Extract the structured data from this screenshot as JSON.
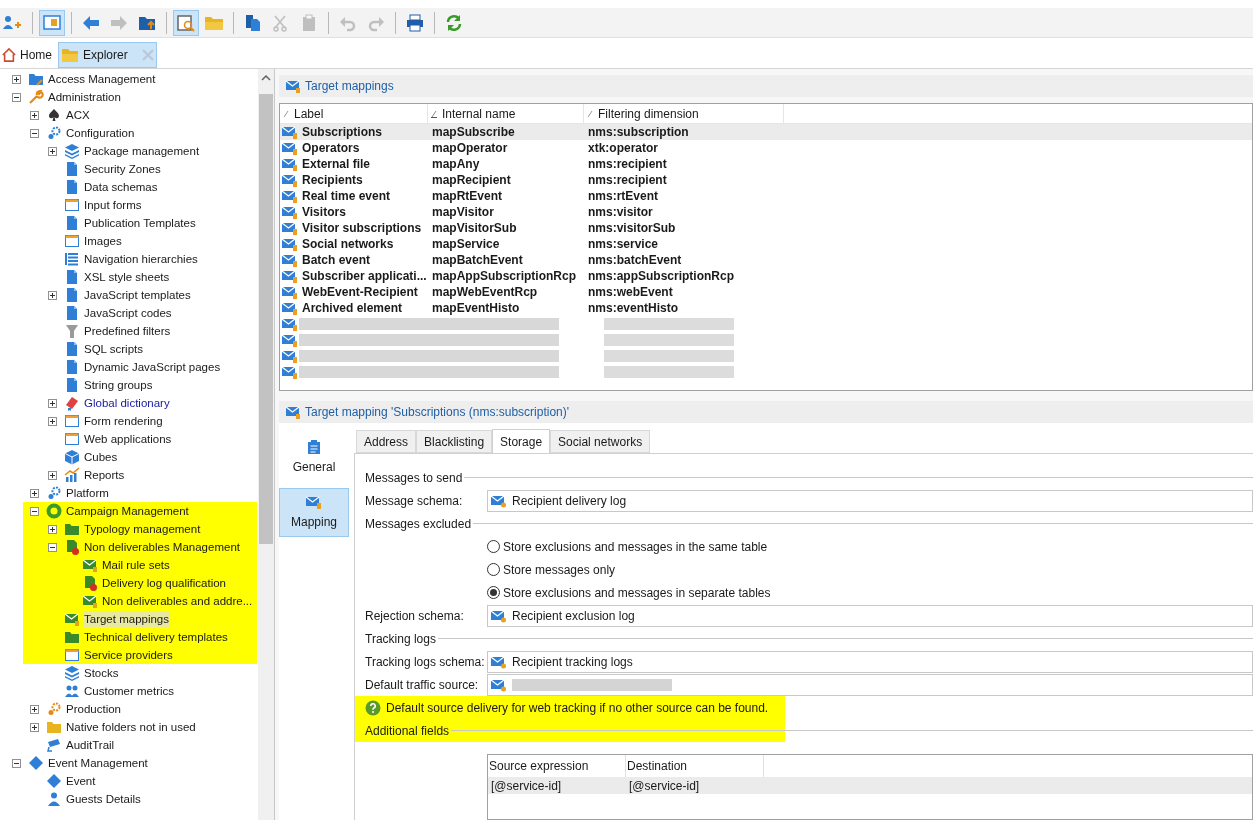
{
  "toolbar": [
    {
      "kind": "add-user",
      "pressed": false,
      "disabled": false
    },
    {
      "kind": "separator"
    },
    {
      "kind": "panel",
      "pressed": true,
      "disabled": false
    },
    {
      "kind": "separator"
    },
    {
      "kind": "back",
      "pressed": false,
      "disabled": false
    },
    {
      "kind": "forward",
      "pressed": false,
      "disabled": true
    },
    {
      "kind": "folder-up",
      "pressed": false,
      "disabled": false
    },
    {
      "kind": "separator"
    },
    {
      "kind": "preview",
      "pressed": true,
      "disabled": false
    },
    {
      "kind": "folder",
      "pressed": false,
      "disabled": false
    },
    {
      "kind": "separator"
    },
    {
      "kind": "copy",
      "pressed": false,
      "disabled": false
    },
    {
      "kind": "cut",
      "pressed": false,
      "disabled": true
    },
    {
      "kind": "paste",
      "pressed": false,
      "disabled": true
    },
    {
      "kind": "separator"
    },
    {
      "kind": "undo",
      "pressed": false,
      "disabled": true
    },
    {
      "kind": "redo",
      "pressed": false,
      "disabled": true
    },
    {
      "kind": "separator"
    },
    {
      "kind": "print",
      "pressed": false,
      "disabled": false
    },
    {
      "kind": "separator"
    },
    {
      "kind": "refresh",
      "pressed": false,
      "disabled": false
    }
  ],
  "tabs": [
    {
      "label": "Home",
      "kind": "home",
      "selected": false,
      "closable": false
    },
    {
      "label": "Explorer",
      "kind": "folder",
      "selected": true,
      "closable": true
    }
  ],
  "tree": [
    {
      "label": "Access Management",
      "kind": "folder-blue",
      "expanded": false,
      "selected": false,
      "highlighted": false
    },
    {
      "label": "Administration",
      "kind": "wrench",
      "expanded": true,
      "selected": false,
      "highlighted": false,
      "children": [
        {
          "label": "ACX",
          "kind": "spade",
          "expanded": false,
          "selected": false,
          "highlighted": false
        },
        {
          "label": "Configuration",
          "kind": "gears",
          "expanded": true,
          "selected": false,
          "highlighted": false,
          "children": [
            {
              "label": "Package management",
              "kind": "boxes",
              "expanded": false,
              "selected": false,
              "highlighted": false
            },
            {
              "label": "Security Zones",
              "kind": "doc",
              "selected": false,
              "highlighted": false
            },
            {
              "label": "Data schemas",
              "kind": "doc",
              "selected": false,
              "highlighted": false
            },
            {
              "label": "Input forms",
              "kind": "form",
              "selected": false,
              "highlighted": false
            },
            {
              "label": "Publication Templates",
              "kind": "doc",
              "selected": false,
              "highlighted": false
            },
            {
              "label": "Images",
              "kind": "form",
              "selected": false,
              "highlighted": false
            },
            {
              "label": "Navigation hierarchies",
              "kind": "list",
              "selected": false,
              "highlighted": false
            },
            {
              "label": "XSL style sheets",
              "kind": "doc",
              "selected": false,
              "highlighted": false
            },
            {
              "label": "JavaScript templates",
              "kind": "doc",
              "expanded": false,
              "selected": false,
              "highlighted": false
            },
            {
              "label": "JavaScript codes",
              "kind": "doc",
              "selected": false,
              "highlighted": false
            },
            {
              "label": "Predefined filters",
              "kind": "filter",
              "selected": false,
              "highlighted": false
            },
            {
              "label": "SQL scripts",
              "kind": "doc",
              "selected": false,
              "highlighted": false
            },
            {
              "label": "Dynamic JavaScript pages",
              "kind": "doc",
              "selected": false,
              "highlighted": false
            },
            {
              "label": "String groups",
              "kind": "doc",
              "selected": false,
              "highlighted": false
            },
            {
              "label": "Global dictionary",
              "kind": "book",
              "expanded": false,
              "selected": false,
              "highlighted": false,
              "linked": true
            },
            {
              "label": "Form rendering",
              "kind": "form",
              "expanded": false,
              "selected": false,
              "highlighted": false
            },
            {
              "label": "Web applications",
              "kind": "form",
              "selected": false,
              "highlighted": false
            },
            {
              "label": "Cubes",
              "kind": "cube",
              "selected": false,
              "highlighted": false
            },
            {
              "label": "Reports",
              "kind": "chart",
              "expanded": false,
              "selected": false,
              "highlighted": false
            }
          ]
        },
        {
          "label": "Platform",
          "kind": "gears",
          "expanded": false,
          "selected": false,
          "highlighted": false
        },
        {
          "label": "Campaign Management",
          "kind": "ring",
          "expanded": true,
          "selected": false,
          "highlighted": true,
          "children": [
            {
              "label": "Typology management",
              "kind": "folder-green",
              "expanded": false,
              "selected": false,
              "highlighted": true
            },
            {
              "label": "Non deliverables Management",
              "kind": "doc-alert",
              "expanded": true,
              "selected": false,
              "highlighted": true,
              "children": [
                {
                  "label": "Mail rule sets",
                  "kind": "mail-green",
                  "selected": false,
                  "highlighted": true
                },
                {
                  "label": "Delivery log qualification",
                  "kind": "doc-alert",
                  "selected": false,
                  "highlighted": true
                },
                {
                  "label": "Non deliverables and addre...",
                  "kind": "mail-green",
                  "selected": false,
                  "highlighted": true
                }
              ]
            },
            {
              "label": "Target mappings",
              "kind": "mail-green",
              "selected": true,
              "highlighted": true
            },
            {
              "label": "Technical delivery templates",
              "kind": "folder-green",
              "selected": false,
              "highlighted": true
            },
            {
              "label": "Service providers",
              "kind": "form",
              "selected": false,
              "highlighted": true
            },
            {
              "label": "Stocks",
              "kind": "boxes",
              "selected": false,
              "highlighted": false
            },
            {
              "label": "Customer metrics",
              "kind": "people",
              "selected": false,
              "highlighted": false
            }
          ]
        },
        {
          "label": "Production",
          "kind": "gears-orange",
          "expanded": false,
          "selected": false,
          "highlighted": false
        },
        {
          "label": "Native folders not in used",
          "kind": "folder-yellow",
          "expanded": false,
          "selected": false,
          "highlighted": false
        },
        {
          "label": "AuditTrail",
          "kind": "camera",
          "selected": false,
          "highlighted": false
        }
      ]
    },
    {
      "label": "Event Management",
      "kind": "diamond",
      "expanded": true,
      "selected": false,
      "highlighted": false,
      "children": [
        {
          "label": "Event",
          "kind": "diamond",
          "selected": false,
          "highlighted": false
        },
        {
          "label": "Guests Details",
          "kind": "person",
          "selected": false,
          "highlighted": false
        }
      ]
    }
  ],
  "list": {
    "title": "Target mappings",
    "columns": [
      {
        "label": "Label",
        "sorted": false
      },
      {
        "label": "Internal name",
        "sorted": true
      },
      {
        "label": "Filtering dimension",
        "sorted": false
      }
    ],
    "rows": [
      {
        "label": "Subscriptions",
        "internal_name": "mapSubscribe",
        "dimension": "nms:subscription",
        "selected": true
      },
      {
        "label": "Operators",
        "internal_name": "mapOperator",
        "dimension": "xtk:operator",
        "selected": false
      },
      {
        "label": "External file",
        "internal_name": "mapAny",
        "dimension": "nms:recipient",
        "selected": false
      },
      {
        "label": "Recipients",
        "internal_name": "mapRecipient",
        "dimension": "nms:recipient",
        "selected": false
      },
      {
        "label": "Real time event",
        "internal_name": "mapRtEvent",
        "dimension": "nms:rtEvent",
        "selected": false
      },
      {
        "label": "Visitors",
        "internal_name": "mapVisitor",
        "dimension": "nms:visitor",
        "selected": false
      },
      {
        "label": "Visitor subscriptions",
        "internal_name": "mapVisitorSub",
        "dimension": "nms:visitorSub",
        "selected": false
      },
      {
        "label": "Social networks",
        "internal_name": "mapService",
        "dimension": "nms:service",
        "selected": false
      },
      {
        "label": "Batch event",
        "internal_name": "mapBatchEvent",
        "dimension": "nms:batchEvent",
        "selected": false
      },
      {
        "label": "Subscriber applicati...",
        "internal_name": "mapAppSubscriptionRcp",
        "dimension": "nms:appSubscriptionRcp",
        "selected": false
      },
      {
        "label": "WebEvent-Recipient",
        "internal_name": "mapWebEventRcp",
        "dimension": "nms:webEvent",
        "selected": false
      },
      {
        "label": "Archived element",
        "internal_name": "mapEventHisto",
        "dimension": "nms:eventHisto",
        "selected": false
      },
      {
        "redacted": true,
        "selected": false
      },
      {
        "redacted": true,
        "selected": false
      },
      {
        "redacted": true,
        "selected": false
      },
      {
        "redacted": true,
        "selected": false
      }
    ]
  },
  "detail": {
    "title": "Target mapping 'Subscriptions (nms:subscription)'",
    "nav": [
      {
        "label": "General",
        "kind": "clipboard",
        "selected": false
      },
      {
        "label": "Mapping",
        "kind": "mail",
        "selected": true
      }
    ],
    "tabs": [
      {
        "label": "Address",
        "selected": false
      },
      {
        "label": "Blacklisting",
        "selected": false
      },
      {
        "label": "Storage",
        "selected": true
      },
      {
        "label": "Social networks",
        "selected": false
      }
    ],
    "items": [
      {
        "kind": "section",
        "label": "Messages to send",
        "highlighted": false
      },
      {
        "kind": "field",
        "label": "Message schema:",
        "value": "Recipient delivery log"
      },
      {
        "kind": "section",
        "label": "Messages excluded",
        "highlighted": false
      },
      {
        "kind": "radio",
        "label": "Store exclusions and messages in the same table",
        "selected": false
      },
      {
        "kind": "radio",
        "label": "Store messages only",
        "selected": false
      },
      {
        "kind": "radio",
        "label": "Store exclusions and messages in separate tables",
        "selected": true
      },
      {
        "kind": "field",
        "label": "Rejection schema:",
        "value": "Recipient exclusion log"
      },
      {
        "kind": "section",
        "label": "Tracking logs",
        "highlighted": false
      },
      {
        "kind": "field",
        "label": "Tracking logs schema:",
        "value": "Recipient tracking logs"
      },
      {
        "kind": "field",
        "label": "Default traffic source:",
        "redacted": true
      },
      {
        "kind": "note",
        "label": "Default source delivery for web tracking if no other source can be found.",
        "highlighted": true
      },
      {
        "kind": "section",
        "label": "Additional fields",
        "highlighted": true
      },
      {
        "kind": "table",
        "columns": [
          "Source expression",
          "Destination"
        ],
        "rows": [
          [
            "[@service-id]",
            "[@service-id]"
          ]
        ]
      }
    ]
  }
}
